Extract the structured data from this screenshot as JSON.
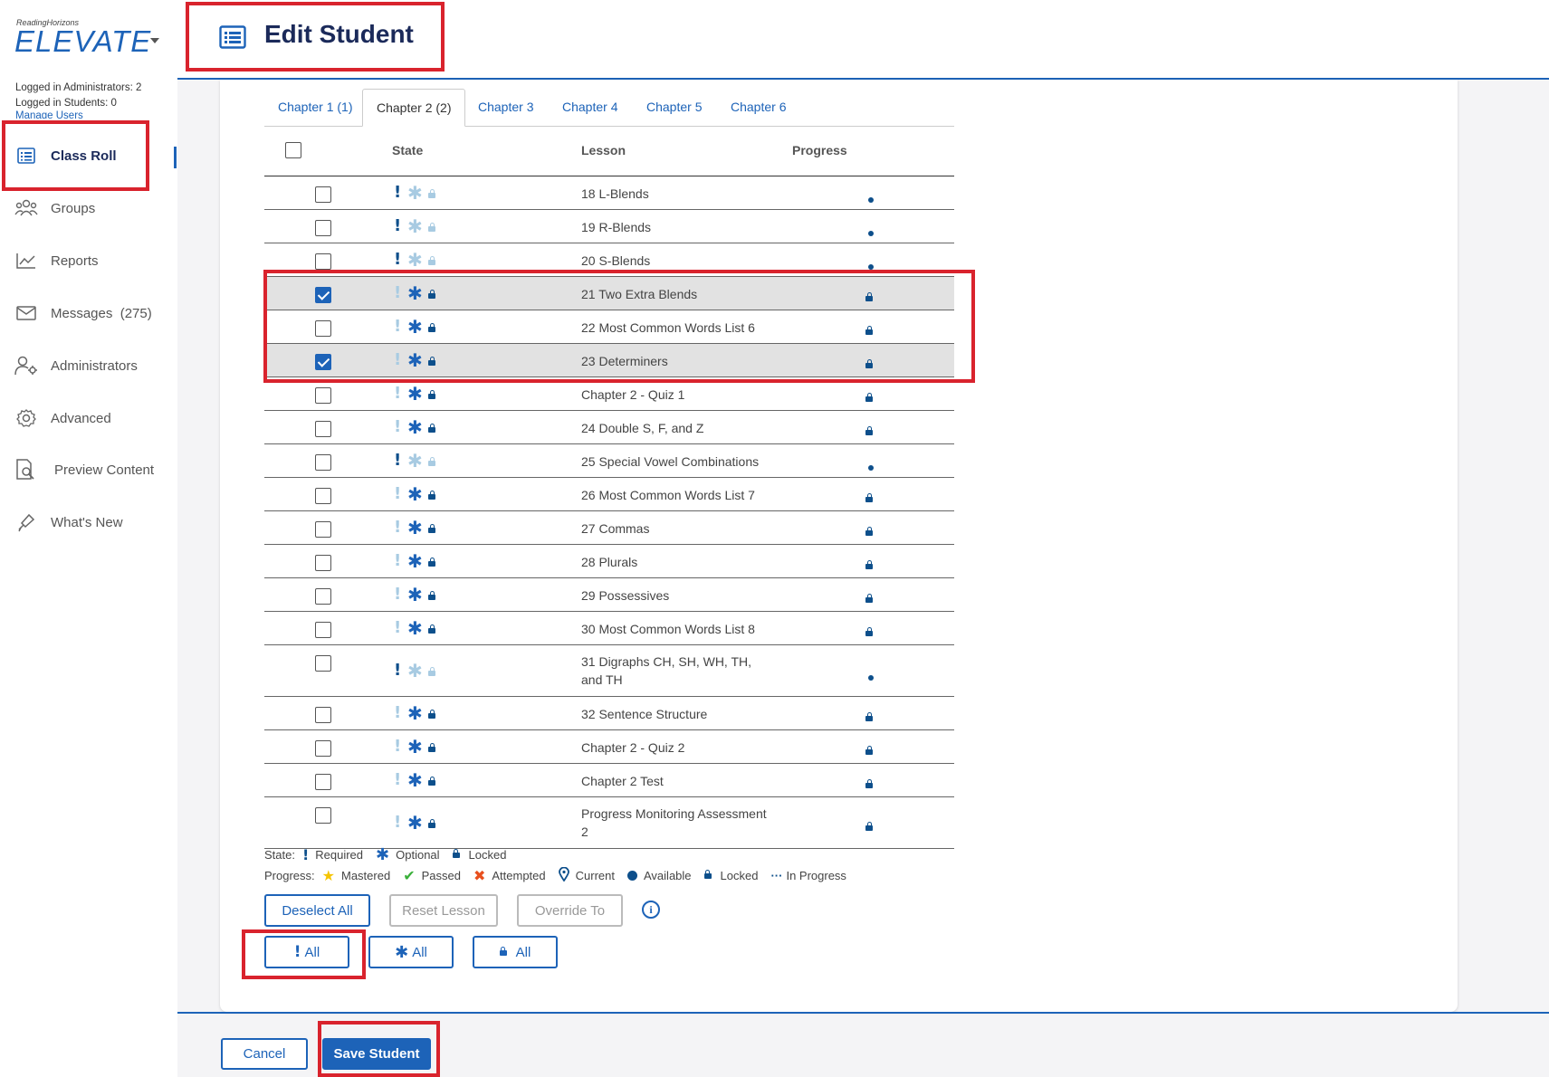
{
  "app": {
    "brand_small": "ReadingHorizons",
    "brand_name": "ELEVATE",
    "logged_admins": "Logged in Administrators: 2",
    "logged_students": "Logged in Students: 0",
    "manage_users": "Manage Users"
  },
  "sidebar": {
    "items": [
      {
        "label": "Class Roll",
        "icon": "list-icon"
      },
      {
        "label": "Groups",
        "icon": "groups-icon"
      },
      {
        "label": "Reports",
        "icon": "chart-icon"
      },
      {
        "label": "Messages  (275)",
        "icon": "envelope-icon"
      },
      {
        "label": "Administrators",
        "icon": "admin-gear-icon"
      },
      {
        "label": "Advanced",
        "icon": "gear-icon"
      },
      {
        "label": "Preview Content",
        "icon": "preview-icon"
      },
      {
        "label": "What's New",
        "icon": "megaphone-icon"
      }
    ]
  },
  "header": {
    "title": "Edit Student"
  },
  "tabs": [
    {
      "label": "Chapter 1 (1)"
    },
    {
      "label": "Chapter 2 (2)",
      "active": true
    },
    {
      "label": "Chapter 3"
    },
    {
      "label": "Chapter 4"
    },
    {
      "label": "Chapter 5"
    },
    {
      "label": "Chapter 6"
    }
  ],
  "table": {
    "headers": {
      "state": "State",
      "lesson": "Lesson",
      "progress": "Progress"
    },
    "rows": [
      {
        "lesson": "18 L-Blends",
        "checked": false,
        "required": true,
        "optional": false,
        "locked": false,
        "progress": "available"
      },
      {
        "lesson": "19 R-Blends",
        "checked": false,
        "required": true,
        "optional": false,
        "locked": false,
        "progress": "available"
      },
      {
        "lesson": "20 S-Blends",
        "checked": false,
        "required": true,
        "optional": false,
        "locked": false,
        "progress": "available"
      },
      {
        "lesson": "21 Two Extra Blends",
        "checked": true,
        "required": false,
        "optional": true,
        "locked": true,
        "progress": "locked"
      },
      {
        "lesson": "22 Most Common Words List 6",
        "checked": false,
        "required": false,
        "optional": true,
        "locked": true,
        "progress": "locked"
      },
      {
        "lesson": "23 Determiners",
        "checked": true,
        "required": false,
        "optional": true,
        "locked": true,
        "progress": "locked"
      },
      {
        "lesson": "Chapter 2 - Quiz 1",
        "checked": false,
        "required": false,
        "optional": true,
        "locked": true,
        "progress": "locked"
      },
      {
        "lesson": "24 Double S, F, and Z",
        "checked": false,
        "required": false,
        "optional": true,
        "locked": true,
        "progress": "locked"
      },
      {
        "lesson": "25 Special Vowel Combinations",
        "checked": false,
        "required": true,
        "optional": false,
        "locked": false,
        "progress": "available"
      },
      {
        "lesson": "26 Most Common Words List 7",
        "checked": false,
        "required": false,
        "optional": true,
        "locked": true,
        "progress": "locked"
      },
      {
        "lesson": "27 Commas",
        "checked": false,
        "required": false,
        "optional": true,
        "locked": true,
        "progress": "locked"
      },
      {
        "lesson": "28 Plurals",
        "checked": false,
        "required": false,
        "optional": true,
        "locked": true,
        "progress": "locked"
      },
      {
        "lesson": "29 Possessives",
        "checked": false,
        "required": false,
        "optional": true,
        "locked": true,
        "progress": "locked"
      },
      {
        "lesson": "30 Most Common Words List 8",
        "checked": false,
        "required": false,
        "optional": true,
        "locked": true,
        "progress": "locked"
      },
      {
        "lesson": "31 Digraphs CH, SH, WH, TH, and TH",
        "checked": false,
        "required": true,
        "optional": false,
        "locked": false,
        "progress": "available"
      },
      {
        "lesson": "32 Sentence Structure",
        "checked": false,
        "required": false,
        "optional": true,
        "locked": true,
        "progress": "locked"
      },
      {
        "lesson": "Chapter 2 - Quiz 2",
        "checked": false,
        "required": false,
        "optional": true,
        "locked": true,
        "progress": "locked"
      },
      {
        "lesson": "Chapter 2 Test",
        "checked": false,
        "required": false,
        "optional": true,
        "locked": true,
        "progress": "locked"
      },
      {
        "lesson": "Progress Monitoring Assessment 2",
        "checked": false,
        "required": false,
        "optional": true,
        "locked": true,
        "progress": "locked"
      }
    ]
  },
  "legend": {
    "state_label": "State:",
    "required": "Required",
    "optional": "Optional",
    "locked": "Locked",
    "progress_label": "Progress:",
    "mastered": "Mastered",
    "passed": "Passed",
    "attempted": "Attempted",
    "current": "Current",
    "available": "Available",
    "locked2": "Locked",
    "in_progress": "In Progress"
  },
  "actions": {
    "deselect_all": "Deselect All",
    "reset_lesson": "Reset Lesson",
    "override_to": "Override To",
    "required_all": "All",
    "optional_all": "All",
    "locked_all": "All"
  },
  "footer": {
    "cancel": "Cancel",
    "save": "Save Student"
  },
  "colors": {
    "accent": "#1d63b8",
    "navy": "#1b2a5a",
    "highlight": "#d9232d"
  }
}
